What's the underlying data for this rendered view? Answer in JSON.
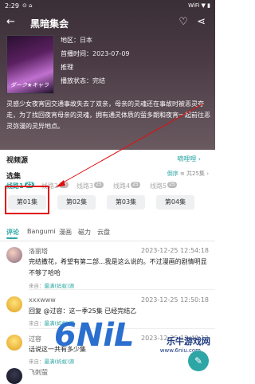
{
  "status": {
    "time": "2:29",
    "icons": "⊙ ⌂",
    "right": "WiFi ▼ ▮"
  },
  "header": {
    "title": "黑暗集会"
  },
  "meta": [
    {
      "k": "地区：",
      "v": "日本"
    },
    {
      "k": "首播时间：",
      "v": "2023-07-09"
    },
    {
      "k": "推理",
      "v": ""
    },
    {
      "k": "播放状态：",
      "v": "完结"
    }
  ],
  "poster_text": "ダーク★キャラ",
  "description": "灵感少女夜宵因交通事故失去了双亲，母亲的灵魂还在事故时被恶灵夺走，为了找回夜宵母亲的灵魂，拥有通灵体质的萤多朗和夜宵一起前往恶灵弥漫的灵异地点。",
  "video_source": {
    "title": "视频源",
    "right": "嘀哩哩 ›"
  },
  "selection": {
    "title": "选集",
    "sort": "倒序",
    "total": "≡ 共25集 ›"
  },
  "routes": [
    {
      "label": "线路1",
      "badge": "25"
    },
    {
      "label": "线路2",
      "badge": "25"
    },
    {
      "label": "线路3",
      "badge": "25"
    },
    {
      "label": "线路4",
      "badge": "25"
    },
    {
      "label": "线路5",
      "badge": "25"
    }
  ],
  "episodes": [
    "第01集",
    "第02集",
    "第03集",
    "第04集"
  ],
  "tabs": [
    "评论",
    "Bangumi",
    "漫画",
    "磁力",
    "云盘"
  ],
  "comments": [
    {
      "name": "洛丽塔",
      "date": "2023-12-25 12:54:18",
      "text": "完结撒花，希望有第二部...我是这么说的。不过漫画的剧情明显不够了哈哈",
      "src_label": "来自：",
      "src": "最满(蚂蚁)源"
    },
    {
      "name": "xxxwww",
      "date": "2023-12-25 12:50:18",
      "text": "回复 @过容：这一季25集 已经完结乙",
      "src_label": "来自：",
      "src": "最满(蚂蚁)源"
    },
    {
      "name": "过容",
      "date": "2023-12-25 12:40:12",
      "text": "话说这一共有多少集",
      "src_label": "来自：",
      "src": "最满(蚂蚁)源"
    },
    {
      "name": "飞刺萤",
      "date": "",
      "text": "",
      "src_label": "",
      "src": ""
    }
  ],
  "watermark": {
    "big": "6NiL",
    "brand": "乐牛游戏网",
    "url": "www.6niu.com"
  }
}
